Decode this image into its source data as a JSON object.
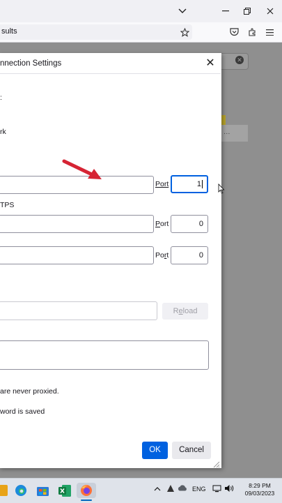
{
  "browser": {
    "url_text": "sults",
    "window_controls": {
      "collapse": "chevron-down-icon",
      "minimize": "minimize-icon",
      "restore": "restore-icon",
      "close": "close-icon"
    }
  },
  "dialog": {
    "title": "nnection Settings",
    "partial_option_1": ":",
    "partial_option_2": "rk",
    "port_label": "Port",
    "http_proxy_port": "1",
    "https_label": "TPS",
    "https_port": "0",
    "socks_port": "0",
    "reload_label": "Reload",
    "no_proxy_note": "are never proxied.",
    "password_note": "word is saved",
    "ok_label": "OK",
    "cancel_label": "Cancel"
  },
  "annotation": {
    "color": "#d62434"
  },
  "taskbar": {
    "lang": "ENG",
    "time": "8:29 PM",
    "date": "09/03/2023"
  },
  "colors": {
    "accent": "#0061e0",
    "page_dim": "#8f8f8f"
  }
}
